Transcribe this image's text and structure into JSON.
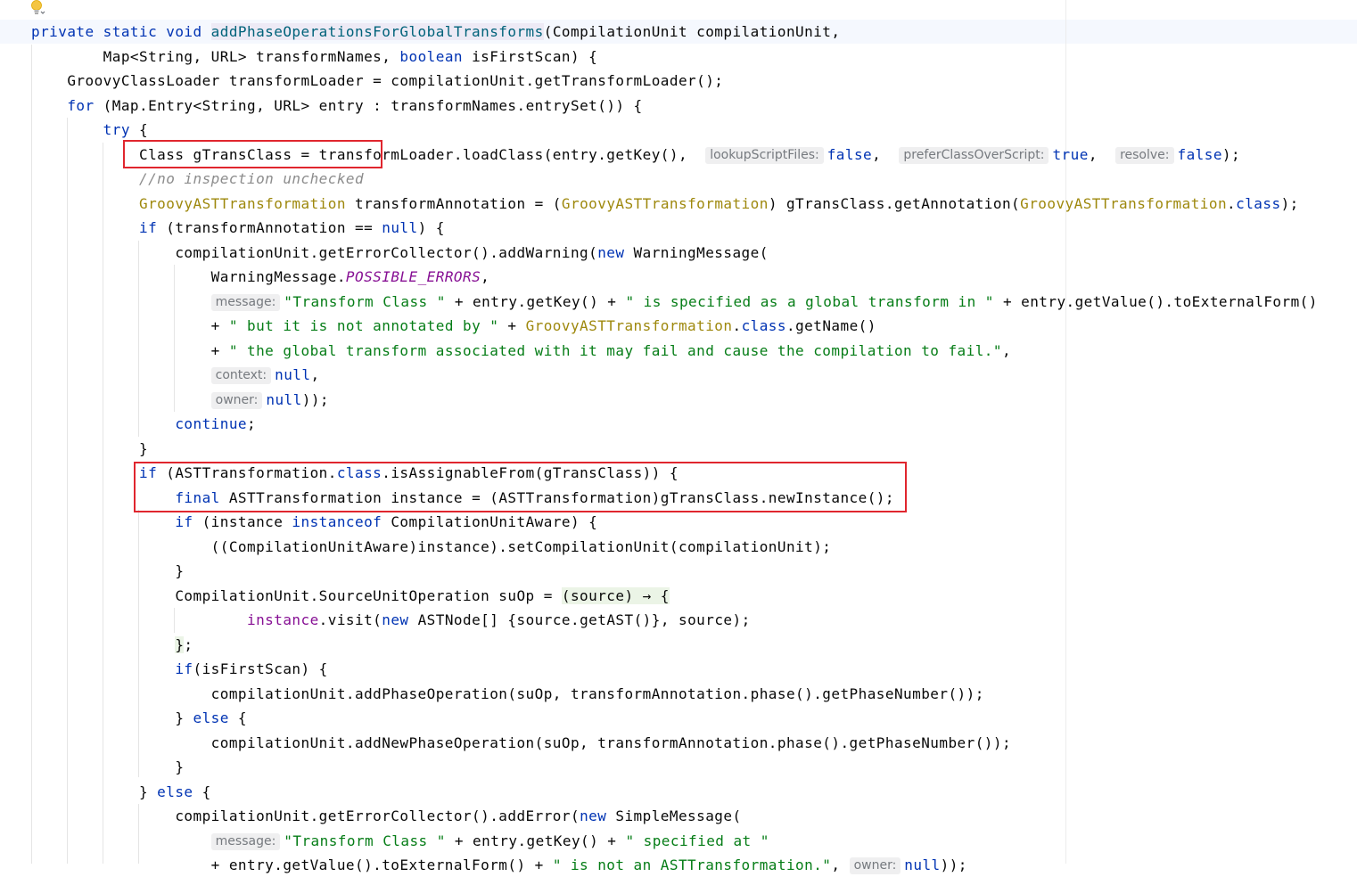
{
  "editor": {
    "lines": [
      [
        {
          "t": "private static void ",
          "c": "kw"
        },
        {
          "t": "addPhaseOperationsForGlobalTransforms",
          "c": "decl-hl"
        },
        {
          "t": "(CompilationUnit compilationUnit,"
        }
      ],
      [
        {
          "t": "        Map<String, URL> transformNames, "
        },
        {
          "t": "boolean",
          "c": "kw"
        },
        {
          "t": " isFirstScan) {"
        }
      ],
      [
        {
          "t": "    GroovyClassLoader transformLoader = compilationUnit.getTransformLoader();"
        }
      ],
      [
        {
          "t": "    "
        },
        {
          "t": "for",
          "c": "kw"
        },
        {
          "t": " (Map.Entry<String, URL> entry : transformNames.entrySet()) {"
        }
      ],
      [
        {
          "t": "        "
        },
        {
          "t": "try",
          "c": "kw"
        },
        {
          "t": " {"
        }
      ],
      [
        {
          "t": "            Class gTransClass = transformLoader.loadClass(entry.getKey(),  "
        },
        {
          "h": "lookupScriptFiles:"
        },
        {
          "t": "false",
          "c": "kw"
        },
        {
          "t": ",  "
        },
        {
          "h": "preferClassOverScript:"
        },
        {
          "t": "true",
          "c": "kw"
        },
        {
          "t": ",  "
        },
        {
          "h": "resolve:"
        },
        {
          "t": "false",
          "c": "kw"
        },
        {
          "t": ");"
        }
      ],
      [
        {
          "t": "            "
        },
        {
          "t": "//no inspection unchecked",
          "c": "cmt"
        }
      ],
      [
        {
          "t": "            "
        },
        {
          "t": "GroovyASTTransformation",
          "c": "ann"
        },
        {
          "t": " transformAnnotation = ("
        },
        {
          "t": "GroovyASTTransformation",
          "c": "ann"
        },
        {
          "t": ") gTransClass.getAnnotation("
        },
        {
          "t": "GroovyASTTransformation",
          "c": "ann"
        },
        {
          "t": "."
        },
        {
          "t": "class",
          "c": "kw"
        },
        {
          "t": ");"
        }
      ],
      [
        {
          "t": "            "
        },
        {
          "t": "if",
          "c": "kw"
        },
        {
          "t": " (transformAnnotation == "
        },
        {
          "t": "null",
          "c": "kw"
        },
        {
          "t": ") {"
        }
      ],
      [
        {
          "t": "                compilationUnit.getErrorCollector().addWarning("
        },
        {
          "t": "new",
          "c": "kw"
        },
        {
          "t": " WarningMessage("
        }
      ],
      [
        {
          "t": "                    WarningMessage."
        },
        {
          "t": "POSSIBLE_ERRORS",
          "c": "sf"
        },
        {
          "t": ","
        }
      ],
      [
        {
          "t": "                    "
        },
        {
          "h": "message:"
        },
        {
          "t": "\"Transform Class \"",
          "c": "str"
        },
        {
          "t": " + entry.getKey() + "
        },
        {
          "t": "\" is specified as a global transform in \"",
          "c": "str"
        },
        {
          "t": " + entry.getValue().toExternalForm()"
        }
      ],
      [
        {
          "t": "                    + "
        },
        {
          "t": "\" but it is not annotated by \"",
          "c": "str"
        },
        {
          "t": " + "
        },
        {
          "t": "GroovyASTTransformation",
          "c": "ann"
        },
        {
          "t": "."
        },
        {
          "t": "class",
          "c": "kw"
        },
        {
          "t": ".getName()"
        }
      ],
      [
        {
          "t": "                    + "
        },
        {
          "t": "\" the global transform associated with it may fail and cause the compilation to fail.\"",
          "c": "str"
        },
        {
          "t": ","
        }
      ],
      [
        {
          "t": "                    "
        },
        {
          "h": "context:"
        },
        {
          "t": "null",
          "c": "kw"
        },
        {
          "t": ","
        }
      ],
      [
        {
          "t": "                    "
        },
        {
          "h": "owner:"
        },
        {
          "t": "null",
          "c": "kw"
        },
        {
          "t": "));"
        }
      ],
      [
        {
          "t": "                "
        },
        {
          "t": "continue",
          "c": "kw"
        },
        {
          "t": ";"
        }
      ],
      [
        {
          "t": "            }"
        }
      ],
      [
        {
          "t": "            "
        },
        {
          "t": "if",
          "c": "kw"
        },
        {
          "t": " (ASTTransformation."
        },
        {
          "t": "class",
          "c": "kw"
        },
        {
          "t": ".isAssignableFrom(gTransClass)) {"
        }
      ],
      [
        {
          "t": "                "
        },
        {
          "t": "final",
          "c": "kw"
        },
        {
          "t": " ASTTransformation instance = (ASTTransformation)gTransClass.newInstance();"
        }
      ],
      [
        {
          "t": "                "
        },
        {
          "t": "if",
          "c": "kw"
        },
        {
          "t": " (instance "
        },
        {
          "t": "instanceof",
          "c": "kw"
        },
        {
          "t": " CompilationUnitAware) {"
        }
      ],
      [
        {
          "t": "                    ((CompilationUnitAware)instance).setCompilationUnit(compilationUnit);"
        }
      ],
      [
        {
          "t": "                }"
        }
      ],
      [
        {
          "t": "                CompilationUnit.SourceUnitOperation suOp = "
        },
        {
          "t": "(source) → {",
          "c": "lambda"
        }
      ],
      [
        {
          "t": "                        "
        },
        {
          "t": "instance",
          "c": "fld"
        },
        {
          "t": ".visit("
        },
        {
          "t": "new",
          "c": "kw"
        },
        {
          "t": " ASTNode[] {source.getAST()}, source);"
        }
      ],
      [
        {
          "t": "                "
        },
        {
          "t": "}",
          "c": "lambda"
        },
        {
          "t": ";"
        }
      ],
      [
        {
          "t": "                "
        },
        {
          "t": "if",
          "c": "kw"
        },
        {
          "t": "(isFirstScan) {"
        }
      ],
      [
        {
          "t": "                    compilationUnit.addPhaseOperation(suOp, transformAnnotation.phase().getPhaseNumber());"
        }
      ],
      [
        {
          "t": "                } "
        },
        {
          "t": "else",
          "c": "kw"
        },
        {
          "t": " {"
        }
      ],
      [
        {
          "t": "                    compilationUnit.addNewPhaseOperation(suOp, transformAnnotation.phase().getPhaseNumber());"
        }
      ],
      [
        {
          "t": "                }"
        }
      ],
      [
        {
          "t": "            } "
        },
        {
          "t": "else",
          "c": "kw"
        },
        {
          "t": " {"
        }
      ],
      [
        {
          "t": "                compilationUnit.getErrorCollector().addError("
        },
        {
          "t": "new",
          "c": "kw"
        },
        {
          "t": " SimpleMessage("
        }
      ],
      [
        {
          "t": "                    "
        },
        {
          "h": "message:"
        },
        {
          "t": "\"Transform Class \"",
          "c": "str"
        },
        {
          "t": " + entry.getKey() + "
        },
        {
          "t": "\" specified at \"",
          "c": "str"
        }
      ],
      [
        {
          "t": "                    + entry.getValue().toExternalForm() + "
        },
        {
          "t": "\" is not an ASTTransformation.\"",
          "c": "str"
        },
        {
          "t": ", "
        },
        {
          "h": "owner:"
        },
        {
          "t": "null",
          "c": "kw"
        },
        {
          "t": "));"
        }
      ]
    ]
  },
  "colors": {
    "keyword": "#0033b3",
    "method": "#00627a",
    "annotation": "#9e880d",
    "string": "#067d17",
    "comment": "#8c8c8c",
    "static_field": "#871094",
    "highlight_box": "#e0262e"
  },
  "icons": {
    "gutter": "intention-bulb-icon"
  }
}
